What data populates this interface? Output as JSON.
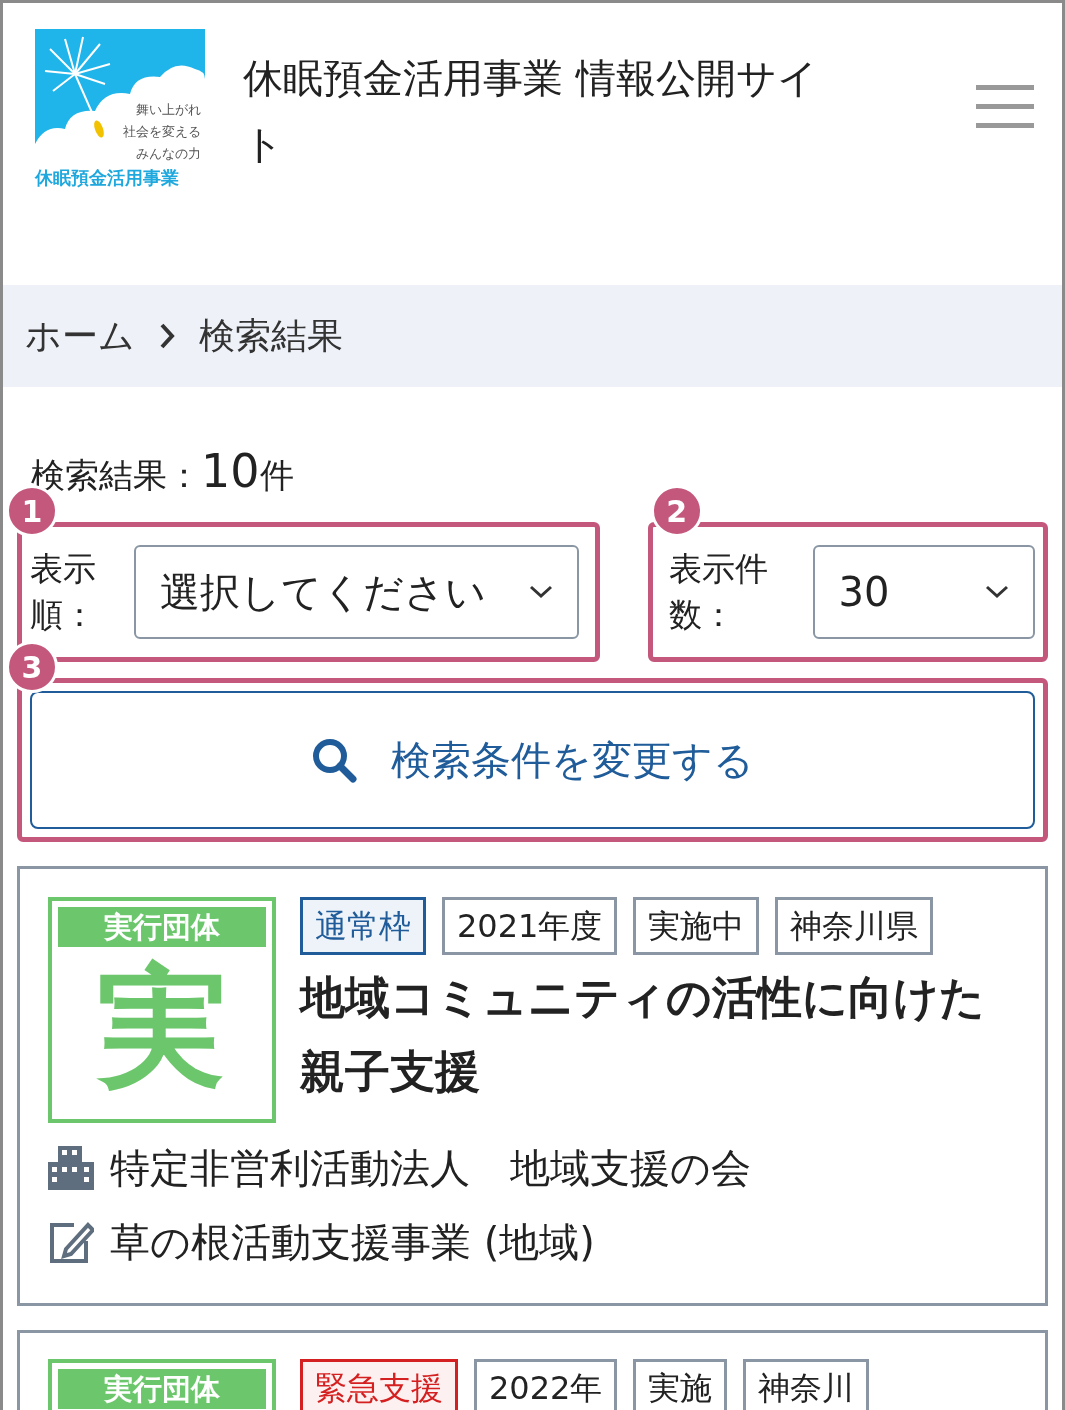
{
  "header": {
    "logo": {
      "slogan": [
        "舞い上がれ",
        "社会を変える",
        "みんなの力"
      ],
      "caption": "休眠預金活用事業"
    },
    "title": "休眠預金活用事業 情報公開サイト"
  },
  "breadcrumb": [
    {
      "label": "ホーム"
    },
    {
      "label": "検索結果"
    }
  ],
  "results": {
    "label": "検索結果：",
    "count": "10",
    "unit": "件"
  },
  "sort": {
    "label": "表示順：",
    "value": "選択してください"
  },
  "per_page": {
    "label": "表示件数：",
    "value": "30"
  },
  "search_button": {
    "label": "検索条件を変更する"
  },
  "annotations": [
    {
      "number": "1"
    },
    {
      "number": "2"
    },
    {
      "number": "3"
    }
  ],
  "cards": [
    {
      "badge_label": "実行団体",
      "badge_char": "実",
      "tags": [
        {
          "label": "通常枠",
          "kind": "category",
          "color": "#1f5c99"
        },
        {
          "label": "2021年度",
          "kind": "plain"
        },
        {
          "label": "実施中",
          "kind": "plain"
        },
        {
          "label": "神奈川県",
          "kind": "plain"
        }
      ],
      "title": "地域コミュニティの活性に向けた親子支援",
      "organization": "特定非営利活動法人　地域支援の会",
      "program": "草の根活動支援事業 (地域)"
    },
    {
      "badge_label": "実行団体",
      "tags": [
        {
          "label": "緊急支援",
          "kind": "category",
          "color": "#d42020"
        },
        {
          "label": "2022年",
          "kind": "plain"
        },
        {
          "label": "実施",
          "kind": "plain"
        },
        {
          "label": "神奈川",
          "kind": "plain"
        }
      ]
    }
  ]
}
